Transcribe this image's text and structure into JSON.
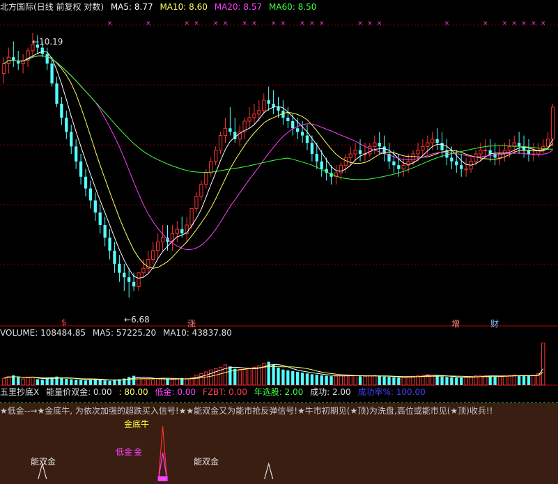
{
  "main": {
    "title": "北方国际(日线 前复权 对数)",
    "ma5": "MA5: 8.77",
    "ma10": "MA10: 8.60",
    "ma20": "MA20: 8.57",
    "ma60": "MA60: 8.50",
    "high_label": "10.19",
    "low_label": "6.68",
    "markers": [
      "$",
      "涨",
      "增",
      "财"
    ]
  },
  "volume": {
    "title": "VOLUME: 108484.85",
    "ma5": "MA5: 57225.20",
    "ma10": "MA10: 43837.80"
  },
  "indicator": {
    "name": "五里抄底X",
    "p1": "能量价双金: 0.00",
    "p2": ": 80.00",
    "p3": "低金: 0.00",
    "p4": "FZBT: 0.00",
    "p5": "年选股: 2.00",
    "p6": "成功: 2.00",
    "p7": "成功率%: 100.00",
    "note": "★低金--→★金底牛, 为依次加强的超跌买入信号!★★能双金又为能市抢反弹信号!★牛市初期见(★顶)为洗盘,高位或能市见(★顶)收兵!!",
    "labels": [
      "能双金",
      "金底牛",
      "低金",
      "金",
      "能双金"
    ]
  },
  "colors": {
    "up": "#ff3232",
    "down": "#54ffff",
    "ma5": "#ffffff",
    "ma10": "#ffff60",
    "ma20": "#ff40ff",
    "ma60": "#40ff40",
    "grid": "#800000"
  },
  "chart_data": {
    "type": "candlestick",
    "ma_periods": [
      5,
      10,
      20,
      60
    ],
    "candles": {
      "open": [
        9.55,
        9.7,
        9.8,
        9.75,
        9.7,
        9.75,
        9.9,
        10.0,
        9.95,
        9.85,
        9.7,
        9.4,
        9.1,
        8.9,
        8.7,
        8.5,
        8.3,
        8.1,
        7.95,
        7.8,
        7.65,
        7.5,
        7.35,
        7.2,
        7.05,
        6.95,
        6.9,
        6.85,
        6.8,
        6.95,
        7.0,
        7.1,
        7.2,
        7.3,
        7.35,
        7.3,
        7.4,
        7.45,
        7.4,
        7.5,
        7.7,
        7.85,
        8.0,
        8.15,
        8.3,
        8.45,
        8.65,
        8.75,
        8.7,
        8.6,
        8.7,
        8.85,
        8.9,
        8.95,
        9.0,
        9.15,
        9.1,
        9.05,
        9.0,
        8.9,
        8.85,
        8.75,
        8.7,
        8.65,
        8.55,
        8.4,
        8.3,
        8.2,
        8.15,
        8.1,
        8.15,
        8.25,
        8.35,
        8.4,
        8.45,
        8.4,
        8.4,
        8.5,
        8.55,
        8.5,
        8.4,
        8.3,
        8.25,
        8.2,
        8.25,
        8.3,
        8.4,
        8.45,
        8.5,
        8.55,
        8.6,
        8.55,
        8.45,
        8.35,
        8.3,
        8.25,
        8.2,
        8.2,
        8.3,
        8.4,
        8.45,
        8.45,
        8.4,
        8.35,
        8.4,
        8.45,
        8.5,
        8.55,
        8.5,
        8.45,
        8.4,
        8.4,
        8.45,
        8.5,
        8.6
      ],
      "high": [
        9.8,
        9.95,
        10.05,
        9.9,
        9.85,
        9.95,
        10.19,
        10.15,
        10.05,
        9.95,
        9.8,
        9.5,
        9.2,
        9.0,
        8.8,
        8.6,
        8.4,
        8.2,
        8.05,
        7.9,
        7.75,
        7.6,
        7.45,
        7.3,
        7.15,
        7.05,
        7.0,
        6.95,
        6.95,
        7.1,
        7.2,
        7.3,
        7.4,
        7.5,
        7.5,
        7.5,
        7.55,
        7.6,
        7.6,
        7.7,
        7.9,
        8.05,
        8.2,
        8.35,
        8.5,
        8.7,
        8.9,
        9.05,
        8.9,
        8.8,
        8.9,
        9.05,
        9.1,
        9.15,
        9.25,
        9.35,
        9.3,
        9.2,
        9.15,
        9.05,
        8.95,
        8.9,
        8.85,
        8.8,
        8.65,
        8.55,
        8.45,
        8.35,
        8.25,
        8.25,
        8.3,
        8.4,
        8.5,
        8.55,
        8.6,
        8.55,
        8.55,
        8.65,
        8.7,
        8.65,
        8.55,
        8.45,
        8.4,
        8.35,
        8.4,
        8.45,
        8.55,
        8.6,
        8.65,
        8.7,
        8.75,
        8.7,
        8.6,
        8.5,
        8.45,
        8.4,
        8.35,
        8.35,
        8.45,
        8.55,
        8.6,
        8.6,
        8.55,
        8.5,
        8.55,
        8.6,
        8.65,
        8.7,
        8.65,
        8.6,
        8.55,
        8.55,
        8.6,
        8.7,
        9.1
      ],
      "low": [
        9.4,
        9.55,
        9.65,
        9.6,
        9.55,
        9.65,
        9.8,
        9.85,
        9.8,
        9.6,
        9.35,
        9.05,
        8.8,
        8.6,
        8.4,
        8.2,
        8.0,
        7.85,
        7.7,
        7.55,
        7.4,
        7.25,
        7.1,
        6.95,
        6.85,
        6.75,
        6.68,
        6.75,
        6.75,
        6.9,
        6.95,
        7.05,
        7.1,
        7.2,
        7.2,
        7.2,
        7.3,
        7.35,
        7.3,
        7.45,
        7.65,
        7.8,
        7.95,
        8.1,
        8.25,
        8.4,
        8.55,
        8.65,
        8.55,
        8.5,
        8.6,
        8.75,
        8.8,
        8.85,
        8.95,
        9.0,
        8.95,
        8.9,
        8.8,
        8.75,
        8.65,
        8.6,
        8.55,
        8.45,
        8.3,
        8.2,
        8.1,
        8.05,
        8.0,
        8.0,
        8.05,
        8.15,
        8.25,
        8.3,
        8.3,
        8.3,
        8.35,
        8.4,
        8.4,
        8.3,
        8.2,
        8.15,
        8.1,
        8.1,
        8.15,
        8.25,
        8.3,
        8.35,
        8.4,
        8.45,
        8.45,
        8.35,
        8.25,
        8.2,
        8.15,
        8.1,
        8.1,
        8.15,
        8.25,
        8.3,
        8.35,
        8.3,
        8.25,
        8.25,
        8.3,
        8.35,
        8.4,
        8.4,
        8.35,
        8.3,
        8.3,
        8.35,
        8.4,
        8.45,
        8.5
      ],
      "close": [
        9.7,
        9.8,
        9.75,
        9.7,
        9.75,
        9.9,
        10.0,
        9.95,
        9.85,
        9.7,
        9.4,
        9.1,
        8.9,
        8.7,
        8.5,
        8.3,
        8.1,
        7.95,
        7.8,
        7.65,
        7.5,
        7.35,
        7.2,
        7.05,
        6.95,
        6.9,
        6.85,
        6.8,
        6.95,
        7.0,
        7.1,
        7.2,
        7.3,
        7.35,
        7.3,
        7.4,
        7.45,
        7.4,
        7.5,
        7.7,
        7.85,
        8.0,
        8.15,
        8.3,
        8.45,
        8.65,
        8.75,
        8.7,
        8.6,
        8.7,
        8.85,
        8.9,
        8.95,
        9.0,
        9.15,
        9.1,
        9.05,
        9.0,
        8.9,
        8.85,
        8.75,
        8.7,
        8.65,
        8.55,
        8.4,
        8.3,
        8.2,
        8.15,
        8.1,
        8.15,
        8.25,
        8.35,
        8.4,
        8.45,
        8.4,
        8.4,
        8.5,
        8.55,
        8.5,
        8.4,
        8.3,
        8.25,
        8.2,
        8.25,
        8.3,
        8.4,
        8.45,
        8.5,
        8.55,
        8.6,
        8.55,
        8.45,
        8.35,
        8.3,
        8.25,
        8.2,
        8.2,
        8.3,
        8.4,
        8.45,
        8.45,
        8.4,
        8.35,
        8.4,
        8.45,
        8.5,
        8.55,
        8.5,
        8.45,
        8.4,
        8.4,
        8.45,
        8.5,
        8.6,
        9.05
      ]
    },
    "volume": [
      18000,
      22000,
      25000,
      20000,
      16000,
      19000,
      21000,
      15000,
      14000,
      17000,
      20000,
      22000,
      19000,
      16000,
      15000,
      14000,
      13000,
      12000,
      14000,
      15000,
      13000,
      12000,
      11000,
      13000,
      15000,
      17000,
      21000,
      24000,
      20000,
      17000,
      15000,
      14000,
      16000,
      18000,
      15000,
      14000,
      16000,
      18000,
      17000,
      20000,
      26000,
      30000,
      34000,
      39000,
      42000,
      46000,
      52000,
      48000,
      42000,
      38000,
      40000,
      44000,
      46000,
      50000,
      56000,
      60000,
      52000,
      45000,
      40000,
      38000,
      36000,
      34000,
      32000,
      30000,
      28000,
      27000,
      25000,
      24000,
      23000,
      22000,
      24000,
      26000,
      25000,
      24000,
      23000,
      22000,
      24000,
      25000,
      23000,
      22000,
      21000,
      20000,
      19000,
      20000,
      22000,
      23000,
      24000,
      26000,
      27000,
      25000,
      24000,
      22000,
      21000,
      20000,
      19000,
      19000,
      20000,
      22000,
      24000,
      25000,
      24000,
      23000,
      22000,
      23000,
      24000,
      25000,
      26000,
      25000,
      24000,
      24000,
      25000,
      30000,
      108484.85
    ],
    "y_scale": "log",
    "ylim": [
      6.5,
      10.5
    ],
    "volume_ylim": [
      0,
      120000
    ],
    "indicator_signals": [
      {
        "index": 8,
        "label": "能双金"
      },
      {
        "index": 33,
        "label": "金底牛"
      },
      {
        "index": 33,
        "label": "低金"
      },
      {
        "index": 55,
        "label": "能双金"
      }
    ],
    "grid": true,
    "top_marks": "x"
  }
}
